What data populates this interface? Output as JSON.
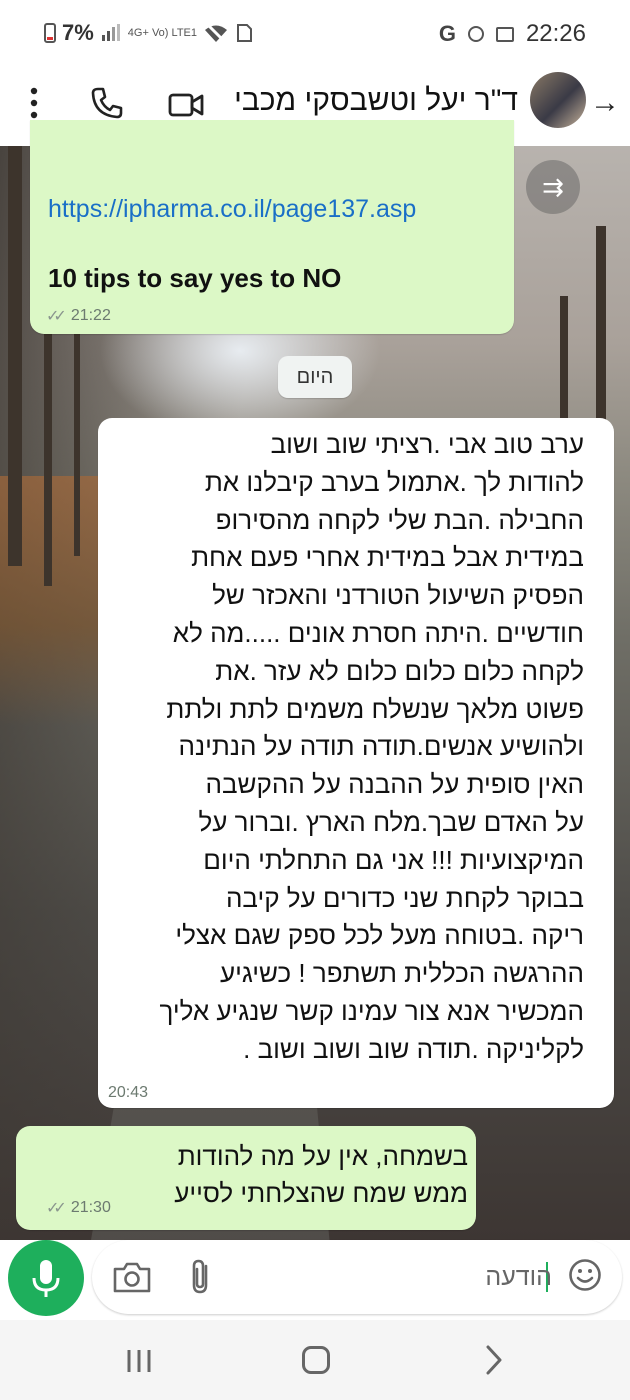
{
  "status_bar": {
    "battery": "7%",
    "network_label": "4G+ Vo) LTE1",
    "carrier_letter": "G",
    "time": "22:26"
  },
  "header": {
    "contact_name": "ד\"ר יעל וטשבסקי מכבי",
    "icons": [
      "back-arrow-icon",
      "avatar",
      "video-call-icon",
      "phone-icon",
      "more-options-icon"
    ]
  },
  "messages": {
    "link_message": {
      "link": "https://ipharma.co.il/page137.asp",
      "text": "10 tips  to say yes to NO",
      "time": "21:22",
      "ticks": "✓✓"
    },
    "date_chip": "היום",
    "incoming": {
      "lines": [
        "ערב טוב אבי .רציתי שוב ושוב",
        "להודות לך .אתמול בערב קיבלנו את",
        "החבילה .הבת שלי לקחה מהסירופ",
        "במידית אבל במידית אחרי פעם אחת",
        "הפסיק השיעול הטורדני והאכזר של",
        "חודשיים .היתה חסרת אונים .....מה לא",
        "לקחה כלום כלום כלום לא עזר .את",
        "פשוט מלאך שנשלח משמים לתת ולתת",
        "ולהושיע אנשים.תודה תודה על הנתינה",
        "האין סופית על ההבנה על ההקשבה",
        "על האדם שבך.מלח הארץ .וברור על",
        "המיקצועיות !!! אני גם התחלתי היום",
        "בבוקר לקחת שני כדורים על קיבה",
        "ריקה .בטוחה מעל לכל ספק שגם אצלי",
        "ההרגשה הכללית תשתפר ! כשיגיע",
        "המכשיר אנא צור עמינו קשר שנגיע אליך",
        "לקליניקה .תודה שוב ושוב ושוב ."
      ],
      "time": "20:43"
    },
    "reply": {
      "lines": [
        "בשמחה, אין על מה להודות",
        "ממש שמח שהצלחתי לסייע"
      ],
      "time": "21:30",
      "ticks": "✓✓"
    }
  },
  "composer": {
    "placeholder": "הודעה",
    "icons": [
      "emoji-icon",
      "attach-icon",
      "camera-icon",
      "mic-icon"
    ]
  },
  "nav_bar": {
    "icons": [
      "recent-apps-icon",
      "home-icon",
      "back-icon"
    ]
  },
  "colors": {
    "accent_green": "#1eaf5c",
    "outgoing_bubble": "#dcf8c6",
    "incoming_bubble": "#ffffff",
    "link_blue": "#1a6fc7"
  }
}
